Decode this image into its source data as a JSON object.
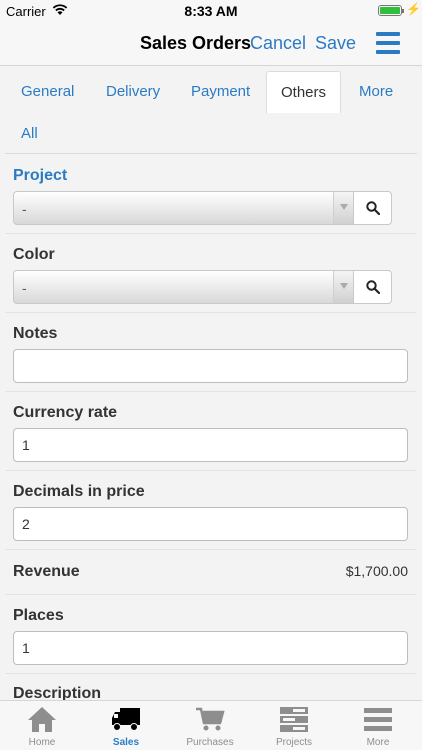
{
  "status_bar": {
    "carrier": "Carrier",
    "time": "8:33 AM"
  },
  "nav": {
    "title": "Sales Orders",
    "cancel": "Cancel",
    "save": "Save",
    "menu_icon": "hamburger-icon"
  },
  "tabs": [
    {
      "label": "General"
    },
    {
      "label": "Delivery"
    },
    {
      "label": "Payment"
    },
    {
      "label": "Others",
      "active": true
    },
    {
      "label": "More"
    },
    {
      "label": "All"
    }
  ],
  "form": {
    "project": {
      "label": "Project",
      "value": "-"
    },
    "color": {
      "label": "Color",
      "value": "-"
    },
    "notes": {
      "label": "Notes",
      "value": ""
    },
    "currency_rate": {
      "label": "Currency rate",
      "value": "1"
    },
    "decimals_in_price": {
      "label": "Decimals in price",
      "value": "2"
    },
    "revenue": {
      "label": "Revenue",
      "value": "$1,700.00"
    },
    "places": {
      "label": "Places",
      "value": "1"
    },
    "description": {
      "label": "Description"
    }
  },
  "tabbar": [
    {
      "label": "Home",
      "icon": "home-icon"
    },
    {
      "label": "Sales",
      "icon": "truck-icon",
      "active": true
    },
    {
      "label": "Purchases",
      "icon": "cart-icon"
    },
    {
      "label": "Projects",
      "icon": "projects-icon"
    },
    {
      "label": "More",
      "icon": "menu-icon"
    }
  ],
  "colors": {
    "accent": "#2b7bc4",
    "battery": "#2fbf3c"
  }
}
